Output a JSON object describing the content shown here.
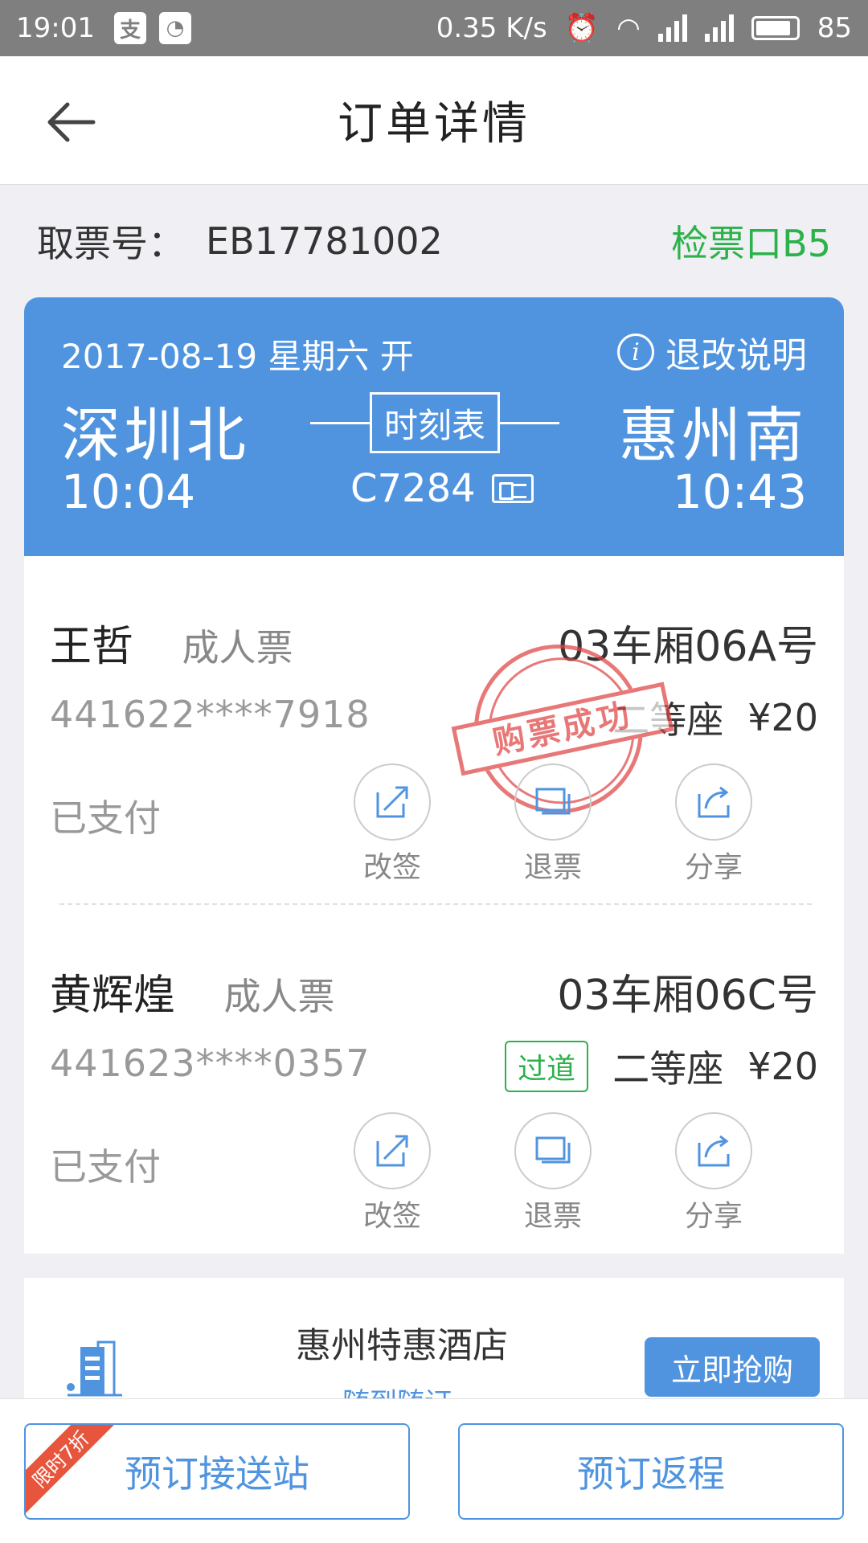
{
  "status_bar": {
    "time": "19:01",
    "app_icon_1": "支",
    "net_speed": "0.35 K/s",
    "network_type": "4G",
    "battery": "85"
  },
  "header": {
    "title": "订单详情",
    "back_icon": "back-arrow-icon"
  },
  "ticket": {
    "pickup_label": "取票号：",
    "pickup_code": "EB17781002",
    "gate": "检票口B5"
  },
  "trip": {
    "date": "2017-08-19 星期六 开",
    "refund_info": "退改说明",
    "from": "深圳北",
    "to": "惠州南",
    "depart_time": "10:04",
    "arrive_time": "10:43",
    "timetable_label": "时刻表",
    "train_no": "C7284"
  },
  "passengers": [
    {
      "name": "王哲",
      "type": "成人票",
      "seat": "03车厢06A号",
      "id_no": "441622****7918",
      "seat_class": "二等座",
      "price": "¥20",
      "status": "已支付",
      "stamp": "购票成功",
      "actions": [
        "改签",
        "退票",
        "分享"
      ]
    },
    {
      "name": "黄辉煌",
      "type": "成人票",
      "seat": "03车厢06C号",
      "id_no": "441623****0357",
      "tag": "过道",
      "seat_class": "二等座",
      "price": "¥20",
      "status": "已支付",
      "actions": [
        "改签",
        "退票",
        "分享"
      ]
    }
  ],
  "hotel_ad": {
    "title": "惠州特惠酒店",
    "subtitle": "随到随订",
    "button": "立即抢购"
  },
  "bottom_bar": {
    "left_button": "预订接送站",
    "left_ribbon": "限时7折",
    "right_button": "预订返程"
  },
  "colors": {
    "primary_blue": "#5094e0",
    "green": "#2cb24a",
    "stamp_red": "#e04545",
    "ribbon_red": "#e8553d"
  }
}
